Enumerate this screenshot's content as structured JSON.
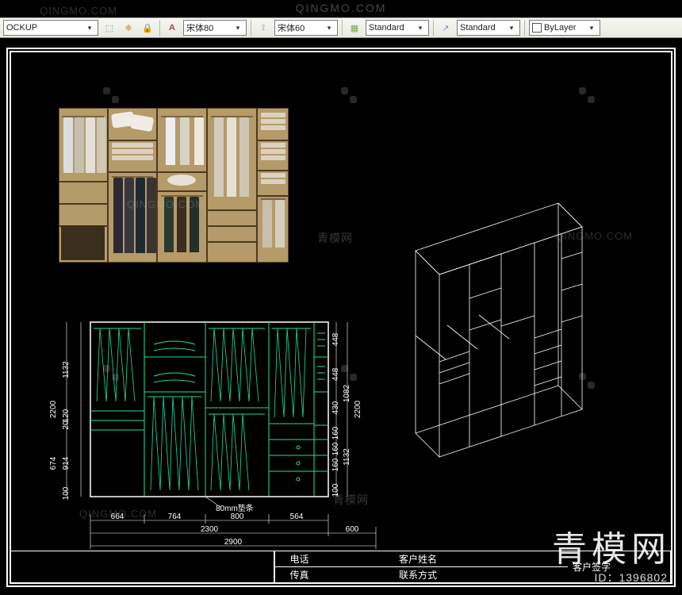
{
  "watermark_url": "QINGMO.COM",
  "watermark_cn": "青模网",
  "toolbar": {
    "layer_select": "OCKUP",
    "text_style": "宋体80",
    "text_style2": "宋体60",
    "dim_style": "Standard",
    "table_style": "Standard",
    "color_style": "ByLayer"
  },
  "cad_note": "80mm垫条",
  "dimensions": {
    "left_col": [
      "1132",
      "120",
      "20",
      "914",
      "674",
      "100"
    ],
    "left_total": "2200",
    "right_col": [
      "448",
      "448",
      "430",
      "1082",
      "2200",
      "1132",
      "160",
      "160",
      "160",
      "100"
    ],
    "bottom": [
      "664",
      "764",
      "800",
      "564"
    ],
    "width_inner": "2300",
    "offset_right": "600",
    "width_total": "2900"
  },
  "title_block": {
    "phone_label": "电话",
    "fax_label": "传真",
    "customer_name_label": "客户姓名",
    "contact_label": "联系方式",
    "customer_sign_label": "客户签字"
  },
  "brand": {
    "text": "青模网",
    "id_label": "ID：1396802"
  }
}
